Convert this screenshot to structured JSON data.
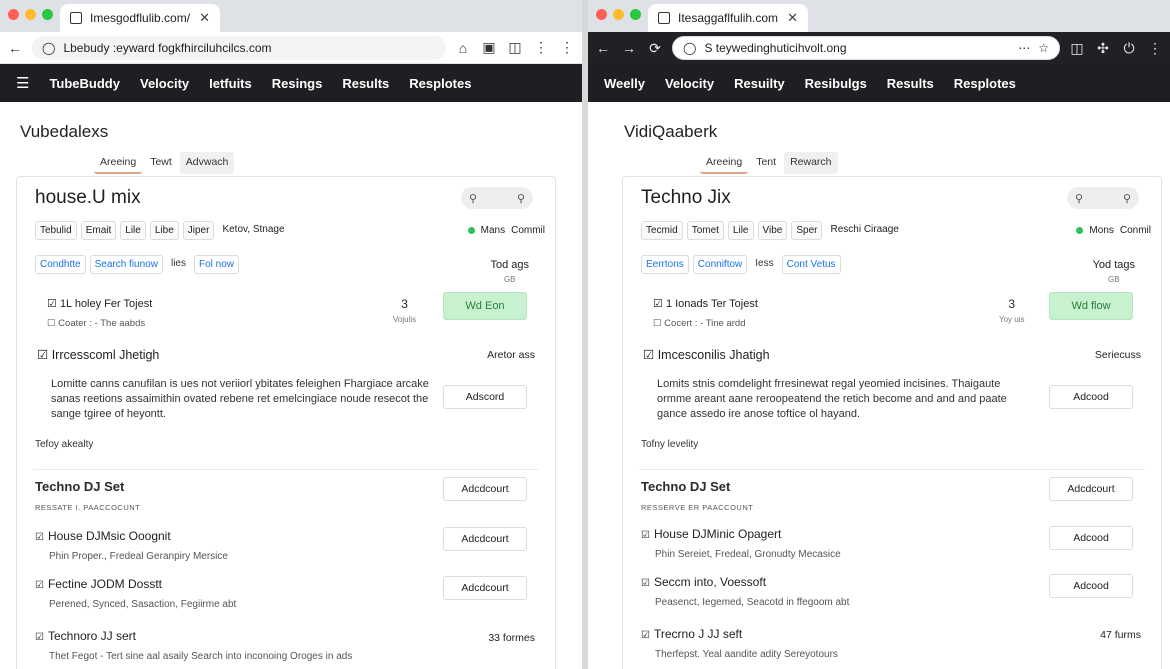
{
  "left": {
    "tab_title": "Imesgodflulib.com/.",
    "address": "Lbebudy :eyward fogkfhirciluhcilcs.com",
    "nav": [
      "TubeBuddy",
      "Velocity",
      "Ietfuits",
      "Resings",
      "Results",
      "Resplotes"
    ],
    "heading": "Vubedalexs",
    "subtabs": [
      "Areeing",
      "Tewt",
      "Advwach"
    ],
    "card_title": "house.U mix",
    "chips": [
      "Tebulid",
      "Emait",
      "Lile",
      "Libe",
      "Jiper"
    ],
    "chips_plain": "Ketov, Stnage",
    "status": "Mans",
    "status2": "Commil",
    "links": [
      "Condhtte",
      "Search fiunow"
    ],
    "links_plain": "lies",
    "links_last": "Fol now",
    "tag_heading": "Tod ags",
    "tag_sub": "GB",
    "rowA_title": "1L holey Fer Tojest",
    "rowA_sub": "Coater : - The aabds",
    "count": "3",
    "count_label": "Vojulis",
    "green_btn": "Wd Eon",
    "rowB_title": "Irrcesscoml Jhetigh",
    "rowB_right": "Aretor ass",
    "para": "Lomitte canns canufilan is ues not veriiorl ybitates feleighen Fhargiace arcake sanas reetions assaimithin ovated rebene ret emelcingiace noude resecot the sange tgiree of heyontt.",
    "para_btn": "Adscord",
    "small": "Tefoy akealty",
    "section": "Techno DJ Set",
    "section_btn": "Adcdcourt",
    "section_sub": "RESSATE I. PAACCOCUNT",
    "items": [
      {
        "title": "House DJMsic Ooognit",
        "sub": "Phin Proper., Fredeal Geranpiry Mersice",
        "right": "Adcdcourt",
        "type": "btn"
      },
      {
        "title": "Fectine JODM Dosstt",
        "sub": "Perened, Synced, Sasaction, Fegiirme abt",
        "right": "Adcdcourt",
        "type": "btn"
      },
      {
        "title": "Technoro JJ sert",
        "sub": "Thet Fegot - Tert sine aal asaily Search into inconoing Oroges in ads",
        "right": "33 formes",
        "type": "text"
      }
    ]
  },
  "right": {
    "tab_title": "Itesaggaflfulih.com.",
    "address": "S teywedinghuticihvolt.ong",
    "nav": [
      "Weelly",
      "Velocity",
      "Resuilty",
      "Resibulgs",
      "Results",
      "Resplotes"
    ],
    "heading": "VidiQaaberk",
    "subtabs": [
      "Areeing",
      "Tent",
      "Rewarch"
    ],
    "card_title": "Techno Jix",
    "chips": [
      "Tecmid",
      "Tomet",
      "Lile",
      "Vibe",
      "Sper"
    ],
    "chips_plain": "Reschi Ciraage",
    "status": "Mons",
    "status2": "Conmil",
    "links": [
      "Eerrtons",
      "Conniftow"
    ],
    "links_plain": "Iess",
    "links_last": "Cont Vetus",
    "tag_heading": "Yod tags",
    "tag_sub": "GB",
    "rowA_title": "1 Ionads Ter Tojest",
    "rowA_sub": "Cocert : - Tine ardd",
    "count": "3",
    "count_label": "Yoy uis",
    "green_btn": "Wd flow",
    "rowB_title": "Imcesconilis Jhatigh",
    "rowB_right": "Seriecuss",
    "para": "Lomits stnis comdelight frresinewat regal yeomied incisines. Thaigaute ormme areant aane reroopeatend the retich become and and and paate gance assedo ire anose toftice ol hayand.",
    "para_btn": "Adcood",
    "small": "Tofny levelity",
    "section": "Techno DJ Set",
    "section_btn": "Adcdcourt",
    "section_sub": "RESSERVE ER PAACCOUNT",
    "items": [
      {
        "title": "House DJMinic Opagert",
        "sub": "Phin Sereiet, Fredeal, Gronudty Mecasice",
        "right": "Adcood",
        "type": "btn"
      },
      {
        "title": "Seccm into, Voessoft",
        "sub": "Peasenct, Iegemed, Seacotd in ffegoom abt",
        "right": "Adcood",
        "type": "btn"
      },
      {
        "title": "Trecrno J JJ seft",
        "sub": "Therfepst. Yeal aandite adity Sereyotours",
        "right": "47 furms",
        "type": "text"
      }
    ]
  },
  "colors": {
    "nav_bg": "#1d1f22",
    "green_btn": "#c8f1cf",
    "status_dot": "#2fbf5f",
    "traffic": [
      "#ff5f57",
      "#febc2e",
      "#28c840"
    ]
  }
}
